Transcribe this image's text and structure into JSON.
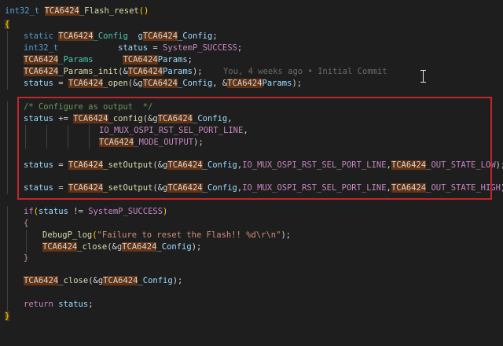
{
  "editor": {
    "signature": {
      "ret": "int32_t",
      "fn_prefix": "TCA6424",
      "fn_rest": "_Flash_reset",
      "parens": "()"
    },
    "open_brace": "{",
    "close_brace": "}",
    "decls": [
      {
        "static": "static",
        "type_prefix": "TCA6424",
        "type_rest": "_Config",
        "var_pre": "g",
        "var_hl": "TCA6424",
        "var_rest": "_Config",
        "end": ";"
      },
      {
        "type": "int32_t",
        "var": "status",
        "eq": " = ",
        "mac": "SystemP_SUCCESS",
        "end": ";"
      },
      {
        "type_prefix": "TCA6424",
        "type_rest": "_Params",
        "var_hl": "TCA6424",
        "var_rest": "Params",
        "end": ";"
      }
    ],
    "params_init": {
      "fn_prefix": "TCA6424",
      "fn_rest": "_Params_init",
      "args_pre": "(&",
      "arg_hl": "TCA6424",
      "arg_rest": "Params",
      "end": ");"
    },
    "blame": "You, 4 weeks ago • Initial Commit",
    "open_call": {
      "var": "status",
      "eq": " = ",
      "fn_prefix": "TCA6424",
      "fn_rest": "_open",
      "a1_pre": "(&g",
      "a1_hl": "TCA6424",
      "a1_rest": "_Config",
      "sep": ", &",
      "a2_hl": "TCA6424",
      "a2_rest": "Params",
      "end": ");"
    },
    "comment": "/* Configure as output  */",
    "config_call": {
      "var": "status",
      "op": " += ",
      "fn_prefix": "TCA6424",
      "fn_rest": "_config",
      "a1_pre": "(&g",
      "a1_hl": "TCA6424",
      "a1_rest": "_Config",
      "a1_end": ",",
      "a2": "IO_MUX_OSPI_RST_SEL_PORT_LINE",
      "a2_end": ",",
      "a3_hl": "TCA6424",
      "a3_rest": "_MODE_OUTPUT",
      "end": ");"
    },
    "set_low": {
      "var": "status",
      "eq": " = ",
      "fn_prefix": "TCA6424",
      "fn_rest": "_setOutput",
      "a1_pre": "(&g",
      "a1_hl": "TCA6424",
      "a1_rest": "_Config",
      "sep1": ",",
      "a2": "IO_MUX_OSPI_RST_SEL_PORT_LINE",
      "sep2": ",",
      "a3_hl": "TCA6424",
      "a3_rest": "_OUT_STATE_LOW",
      "end": ");"
    },
    "set_high": {
      "var": "status",
      "eq": " = ",
      "fn_prefix": "TCA6424",
      "fn_rest": "_setOutput",
      "a1_pre": "(&g",
      "a1_hl": "TCA6424",
      "a1_rest": "_Config",
      "sep1": ",",
      "a2": "IO_MUX_OSPI_RST_SEL_PORT_LINE",
      "sep2": ",",
      "a3_hl": "TCA6424",
      "a3_rest": "_OUT_STATE_HIGH",
      "end": ");"
    },
    "if_stmt": {
      "kw": "if",
      "open": "(",
      "var": "status",
      "op": " != ",
      "mac": "SystemP_SUCCESS",
      "close": ")"
    },
    "if_open": "{",
    "if_close": "}",
    "debug_log": {
      "fn": "DebugP_log",
      "open": "(",
      "str": "\"Failure to reset the Flash!! %d\\r\\n\"",
      "end": ");"
    },
    "close_in_if": {
      "fn_prefix": "TCA6424",
      "fn_rest": "_close",
      "a_pre": "(&g",
      "a_hl": "TCA6424",
      "a_rest": "_Config",
      "end": ");"
    },
    "close_call": {
      "fn_prefix": "TCA6424",
      "fn_rest": "_close",
      "a_pre": "(&g",
      "a_hl": "TCA6424",
      "a_rest": "_Config",
      "end": ");"
    },
    "return_stmt": {
      "kw": "return",
      "var": "status",
      "end": ";"
    }
  }
}
